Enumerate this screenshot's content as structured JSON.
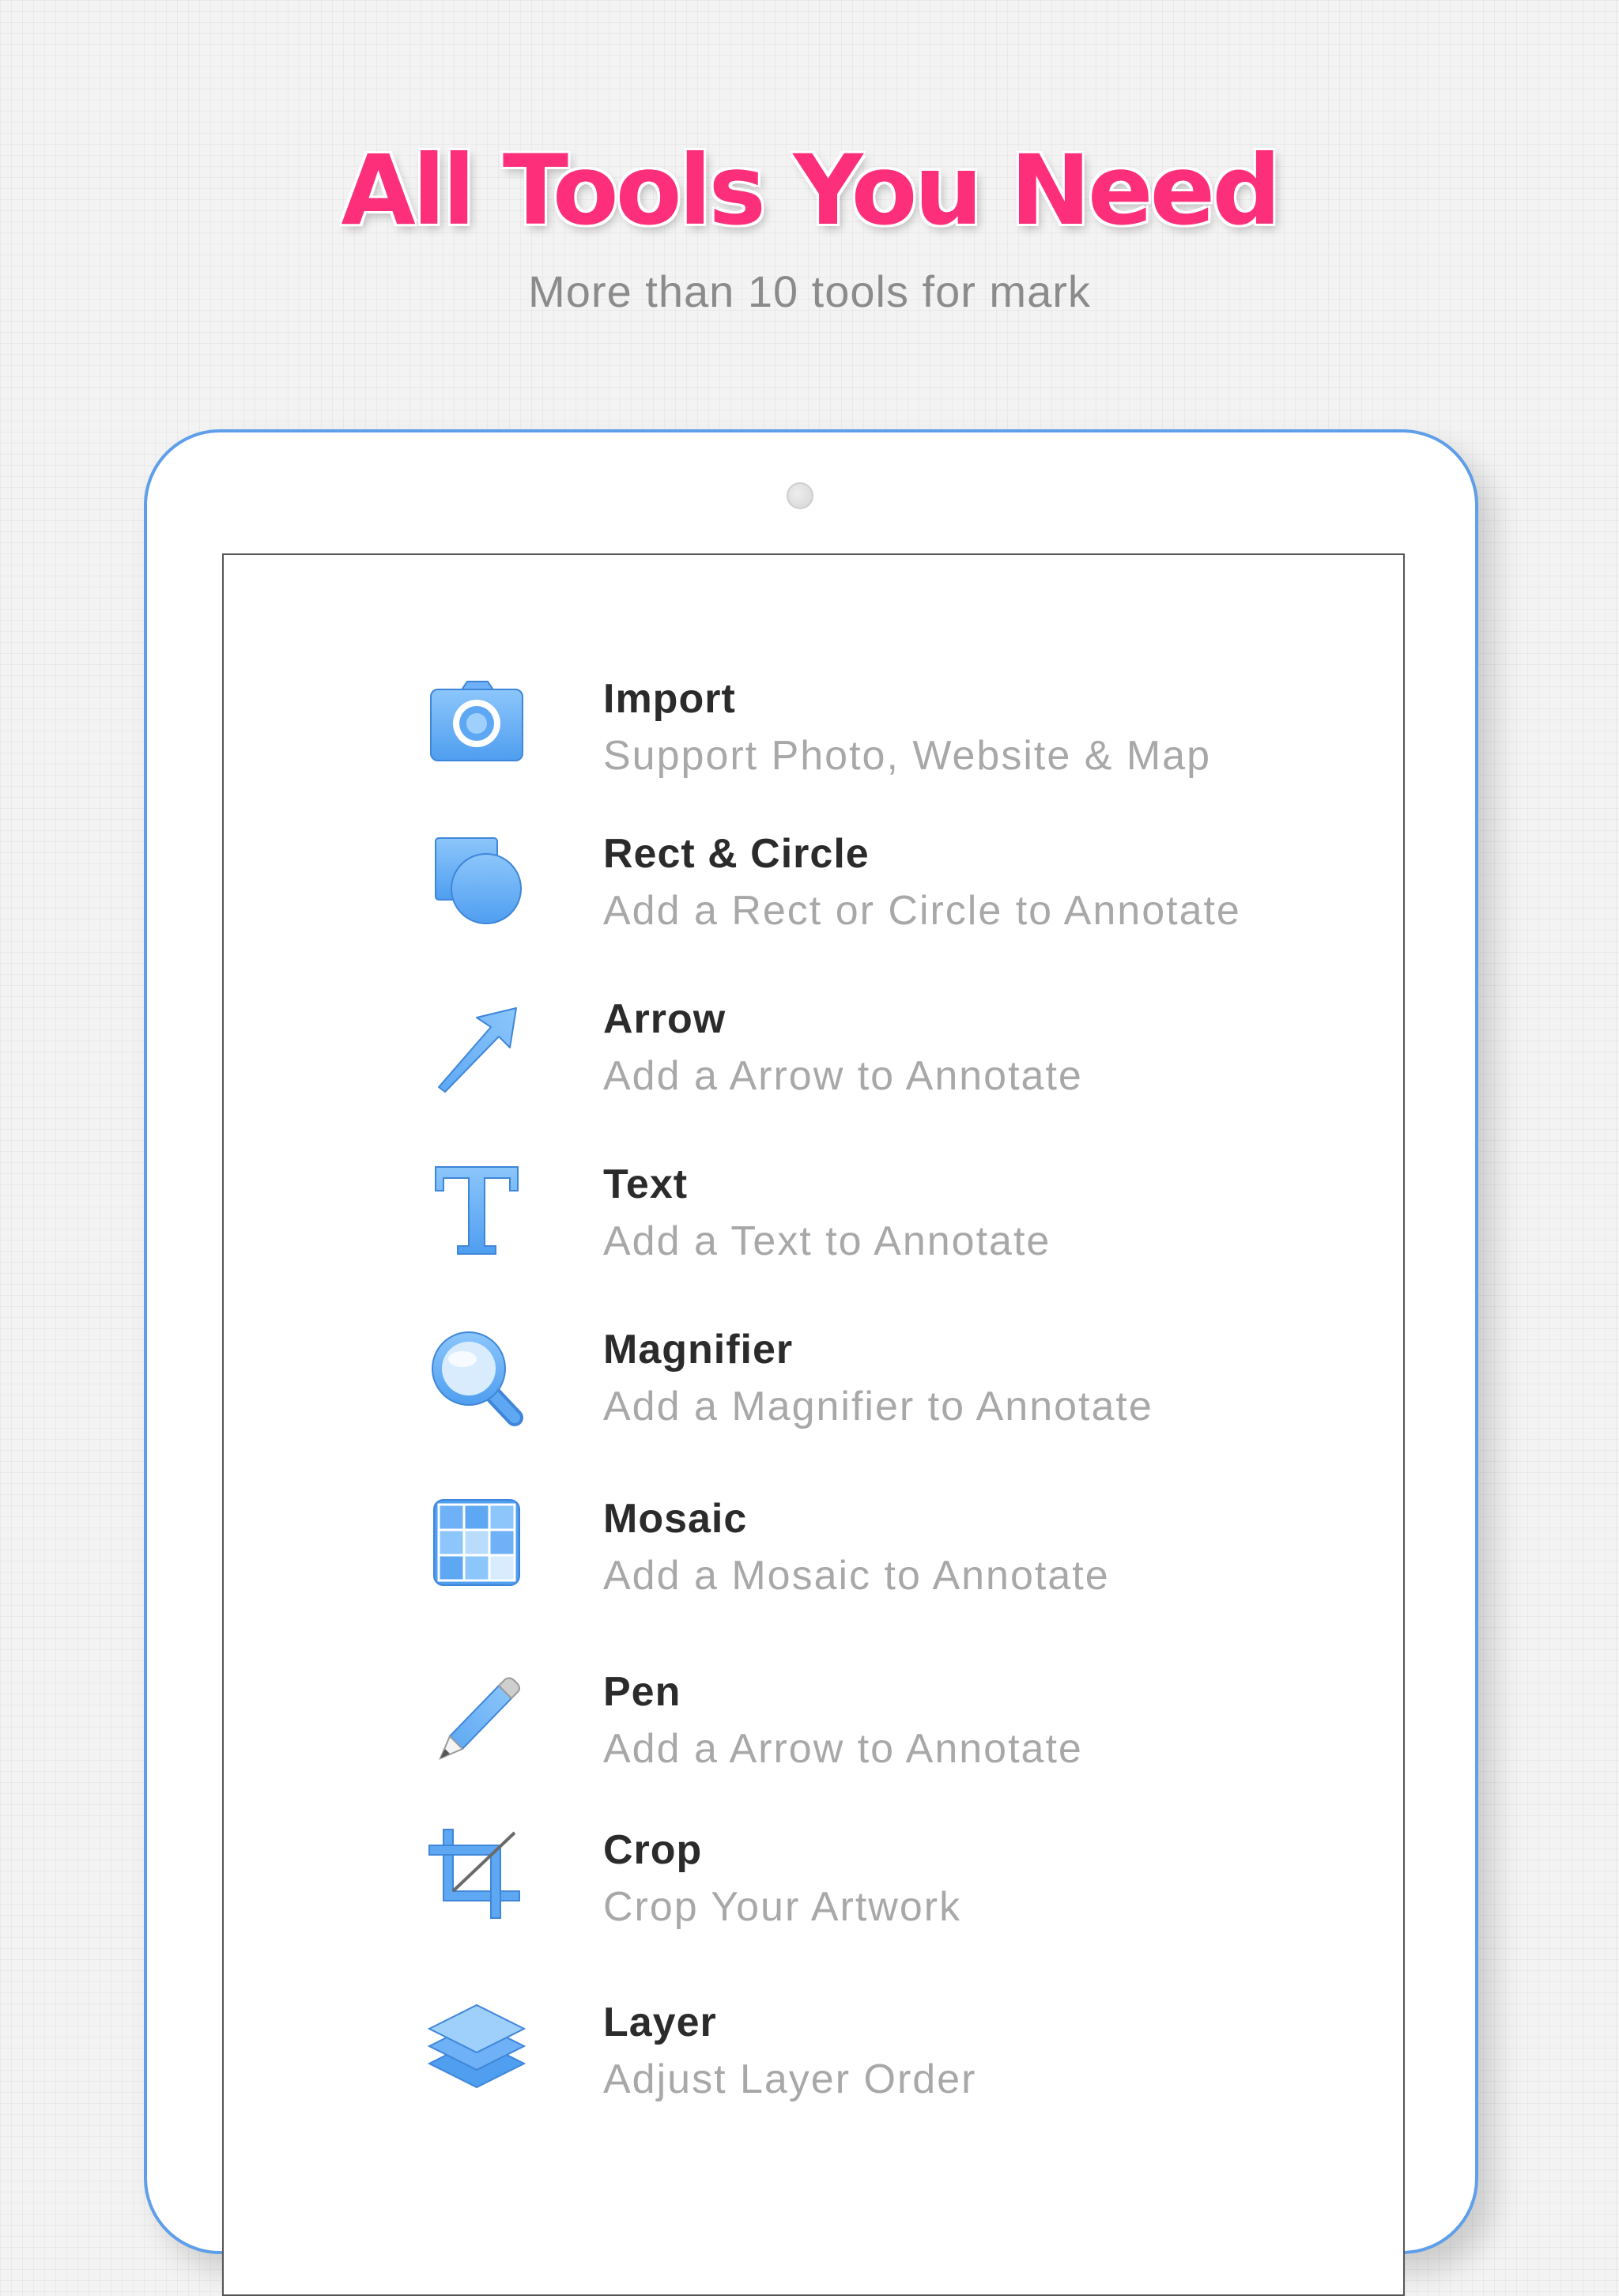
{
  "header": {
    "title": "All Tools You Need",
    "subtitle": "More than 10 tools for mark"
  },
  "theme": {
    "accent": "#fd2f7b",
    "icon_blue": "#5ea8f3",
    "device_border": "#5f9ee8"
  },
  "tools": [
    {
      "title": "Import",
      "description": "Support Photo, Website & Map",
      "icon": "camera-icon"
    },
    {
      "title": "Rect & Circle",
      "description": "Add a Rect or Circle to Annotate",
      "icon": "rect-circle-icon"
    },
    {
      "title": "Arrow",
      "description": "Add a Arrow to Annotate",
      "icon": "arrow-icon"
    },
    {
      "title": "Text",
      "description": "Add a Text to Annotate",
      "icon": "text-icon"
    },
    {
      "title": "Magnifier",
      "description": "Add a Magnifier to Annotate",
      "icon": "magnifier-icon"
    },
    {
      "title": "Mosaic",
      "description": "Add a Mosaic to Annotate",
      "icon": "mosaic-icon"
    },
    {
      "title": "Pen",
      "description": "Add a Arrow to Annotate",
      "icon": "pen-icon"
    },
    {
      "title": "Crop",
      "description": "Crop Your Artwork",
      "icon": "crop-icon"
    },
    {
      "title": "Layer",
      "description": "Adjust Layer Order",
      "icon": "layer-icon"
    }
  ]
}
